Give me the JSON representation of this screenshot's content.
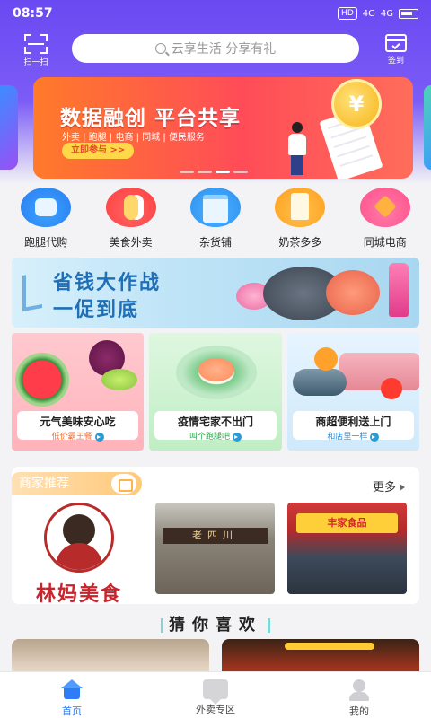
{
  "status_bar": {
    "time": "08:57",
    "hd": "HD",
    "net1": "4G",
    "net2": "4G",
    "battery": "53"
  },
  "header": {
    "scan_label": "扫一扫",
    "search_placeholder": "云享生活 分享有礼",
    "sign_label": "签到"
  },
  "banner": {
    "title": "数据融创 平台共享",
    "subtitle": "外卖 | 跑腿 | 电商 | 同城 | 便民服务",
    "cta": "立即参与 >>",
    "coin_symbol": "¥"
  },
  "categories": [
    {
      "label": "跑腿代购",
      "icon": "courier-box-icon"
    },
    {
      "label": "美食外卖",
      "icon": "food-icon"
    },
    {
      "label": "杂货铺",
      "icon": "grocery-icon"
    },
    {
      "label": "奶茶多多",
      "icon": "milk-tea-icon"
    },
    {
      "label": "同城电商",
      "icon": "heart-shop-icon"
    }
  ],
  "promo": {
    "line1": "省钱大作战",
    "line2": "一促到底"
  },
  "cards": [
    {
      "title": "元气美味安心吃",
      "sub": "低价霸王餐"
    },
    {
      "title": "疫情宅家不出门",
      "sub": "叫个跑腿吧"
    },
    {
      "title": "商超便利送上门",
      "sub": "和店里一样"
    }
  ],
  "merchants": {
    "header": "商家推荐",
    "more": "更多",
    "shop1_name": "林妈美食",
    "shop2_sign": "老四川",
    "shop3_sign": "丰家食品"
  },
  "guess": {
    "title": "猜你喜欢"
  },
  "tabbar": [
    {
      "label": "首页",
      "active": true
    },
    {
      "label": "外卖专区",
      "active": false
    },
    {
      "label": "我的",
      "active": false
    }
  ],
  "colors": {
    "header_purple": "#6a49f2",
    "active_tab": "#2f7cf6",
    "banner_red": "#ff4c58"
  }
}
